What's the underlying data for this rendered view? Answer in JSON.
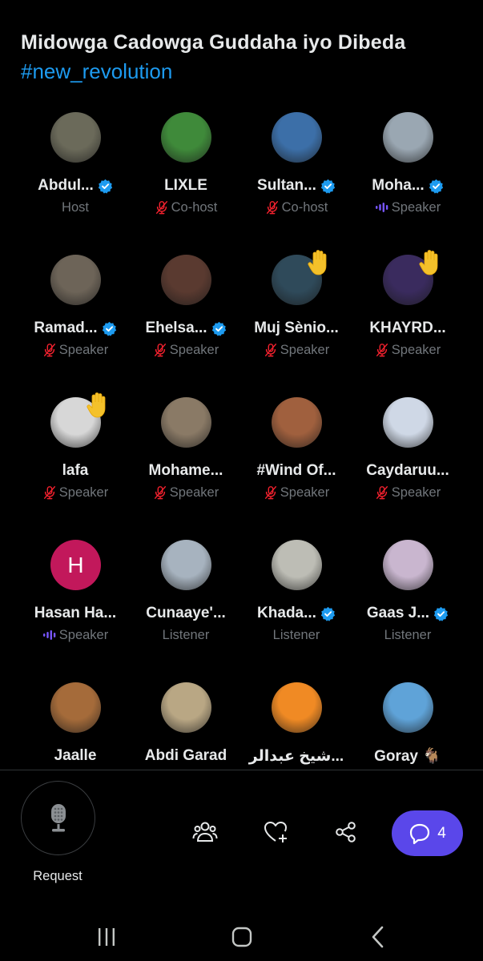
{
  "space": {
    "title": "Midowga Cadowga Guddaha iyo Dibeda",
    "hashtag": "#new_revolution"
  },
  "participants": [
    {
      "name": "Abdul...",
      "role": "Host",
      "verified": true,
      "muted": false,
      "speaking": false,
      "hand": false,
      "avatar_color": "#6b6a5a"
    },
    {
      "name": "LIXLE",
      "role": "Co-host",
      "verified": false,
      "muted": true,
      "speaking": false,
      "hand": false,
      "avatar_color": "#3f8a3a"
    },
    {
      "name": "Sultan...",
      "role": "Co-host",
      "verified": true,
      "muted": true,
      "speaking": false,
      "hand": false,
      "avatar_color": "#3c6fa8"
    },
    {
      "name": "Moha...",
      "role": "Speaker",
      "verified": true,
      "muted": false,
      "speaking": true,
      "hand": false,
      "avatar_color": "#9aa7b2"
    },
    {
      "name": "Ramad...",
      "role": "Speaker",
      "verified": true,
      "muted": true,
      "speaking": false,
      "hand": false,
      "avatar_color": "#6d6458"
    },
    {
      "name": "Ehelsa...",
      "role": "Speaker",
      "verified": true,
      "muted": true,
      "speaking": false,
      "hand": false,
      "avatar_color": "#5a3a30"
    },
    {
      "name": "Muj Sènio...",
      "role": "Speaker",
      "verified": false,
      "muted": true,
      "speaking": false,
      "hand": true,
      "avatar_color": "#2f4a5a"
    },
    {
      "name": "KHAYRD...",
      "role": "Speaker",
      "verified": false,
      "muted": true,
      "speaking": false,
      "hand": true,
      "avatar_color": "#3a2b5e"
    },
    {
      "name": "lafa",
      "role": "Speaker",
      "verified": false,
      "muted": true,
      "speaking": false,
      "hand": true,
      "avatar_color": "#d7d7d7"
    },
    {
      "name": "Mohame...",
      "role": "Speaker",
      "verified": false,
      "muted": true,
      "speaking": false,
      "hand": false,
      "avatar_color": "#8a7a66"
    },
    {
      "name": "#Wind Of...",
      "role": "Speaker",
      "verified": false,
      "muted": true,
      "speaking": false,
      "hand": false,
      "avatar_color": "#a0603e"
    },
    {
      "name": "Caydaruu...",
      "role": "Speaker",
      "verified": false,
      "muted": true,
      "speaking": false,
      "hand": false,
      "avatar_color": "#cfd8e6"
    },
    {
      "name": "Hasan Ha...",
      "role": "Speaker",
      "verified": false,
      "muted": false,
      "speaking": true,
      "hand": false,
      "avatar_color": "#c2185b",
      "letter": "H"
    },
    {
      "name": "Cunaaye'...",
      "role": "Listener",
      "verified": false,
      "muted": false,
      "speaking": false,
      "hand": false,
      "avatar_color": "#a7b3bf"
    },
    {
      "name": "Khada...",
      "role": "Listener",
      "verified": true,
      "muted": false,
      "speaking": false,
      "hand": false,
      "avatar_color": "#bdbdb5"
    },
    {
      "name": "Gaas J...",
      "role": "Listener",
      "verified": true,
      "muted": false,
      "speaking": false,
      "hand": false,
      "avatar_color": "#c9b6cf"
    },
    {
      "name": "Jaalle",
      "role": "",
      "verified": false,
      "muted": false,
      "speaking": false,
      "hand": false,
      "avatar_color": "#a56b3a"
    },
    {
      "name": "Abdi Garad",
      "role": "",
      "verified": false,
      "muted": false,
      "speaking": false,
      "hand": false,
      "avatar_color": "#b9a784"
    },
    {
      "name": "شيخ عبدالر...",
      "role": "",
      "verified": false,
      "muted": false,
      "speaking": false,
      "hand": false,
      "avatar_color": "#f08a24"
    },
    {
      "name": "Goray 🐐",
      "role": "",
      "verified": false,
      "muted": false,
      "speaking": false,
      "hand": false,
      "avatar_color": "#5fa3d8"
    }
  ],
  "bottom_bar": {
    "request_label": "Request",
    "chat_count": "4",
    "icons": [
      "microphone-icon",
      "people-icon",
      "heart-plus-icon",
      "share-icon",
      "chat-bubble-icon"
    ]
  },
  "navbar": {
    "icons": [
      "recent-apps-icon",
      "home-icon",
      "back-icon"
    ]
  },
  "colors": {
    "accent_blue": "#1d9bf0",
    "chat_button": "#5a47ea",
    "muted_red": "#f4212e",
    "speaking_purple": "#7856ff",
    "secondary_text": "#71767b"
  }
}
